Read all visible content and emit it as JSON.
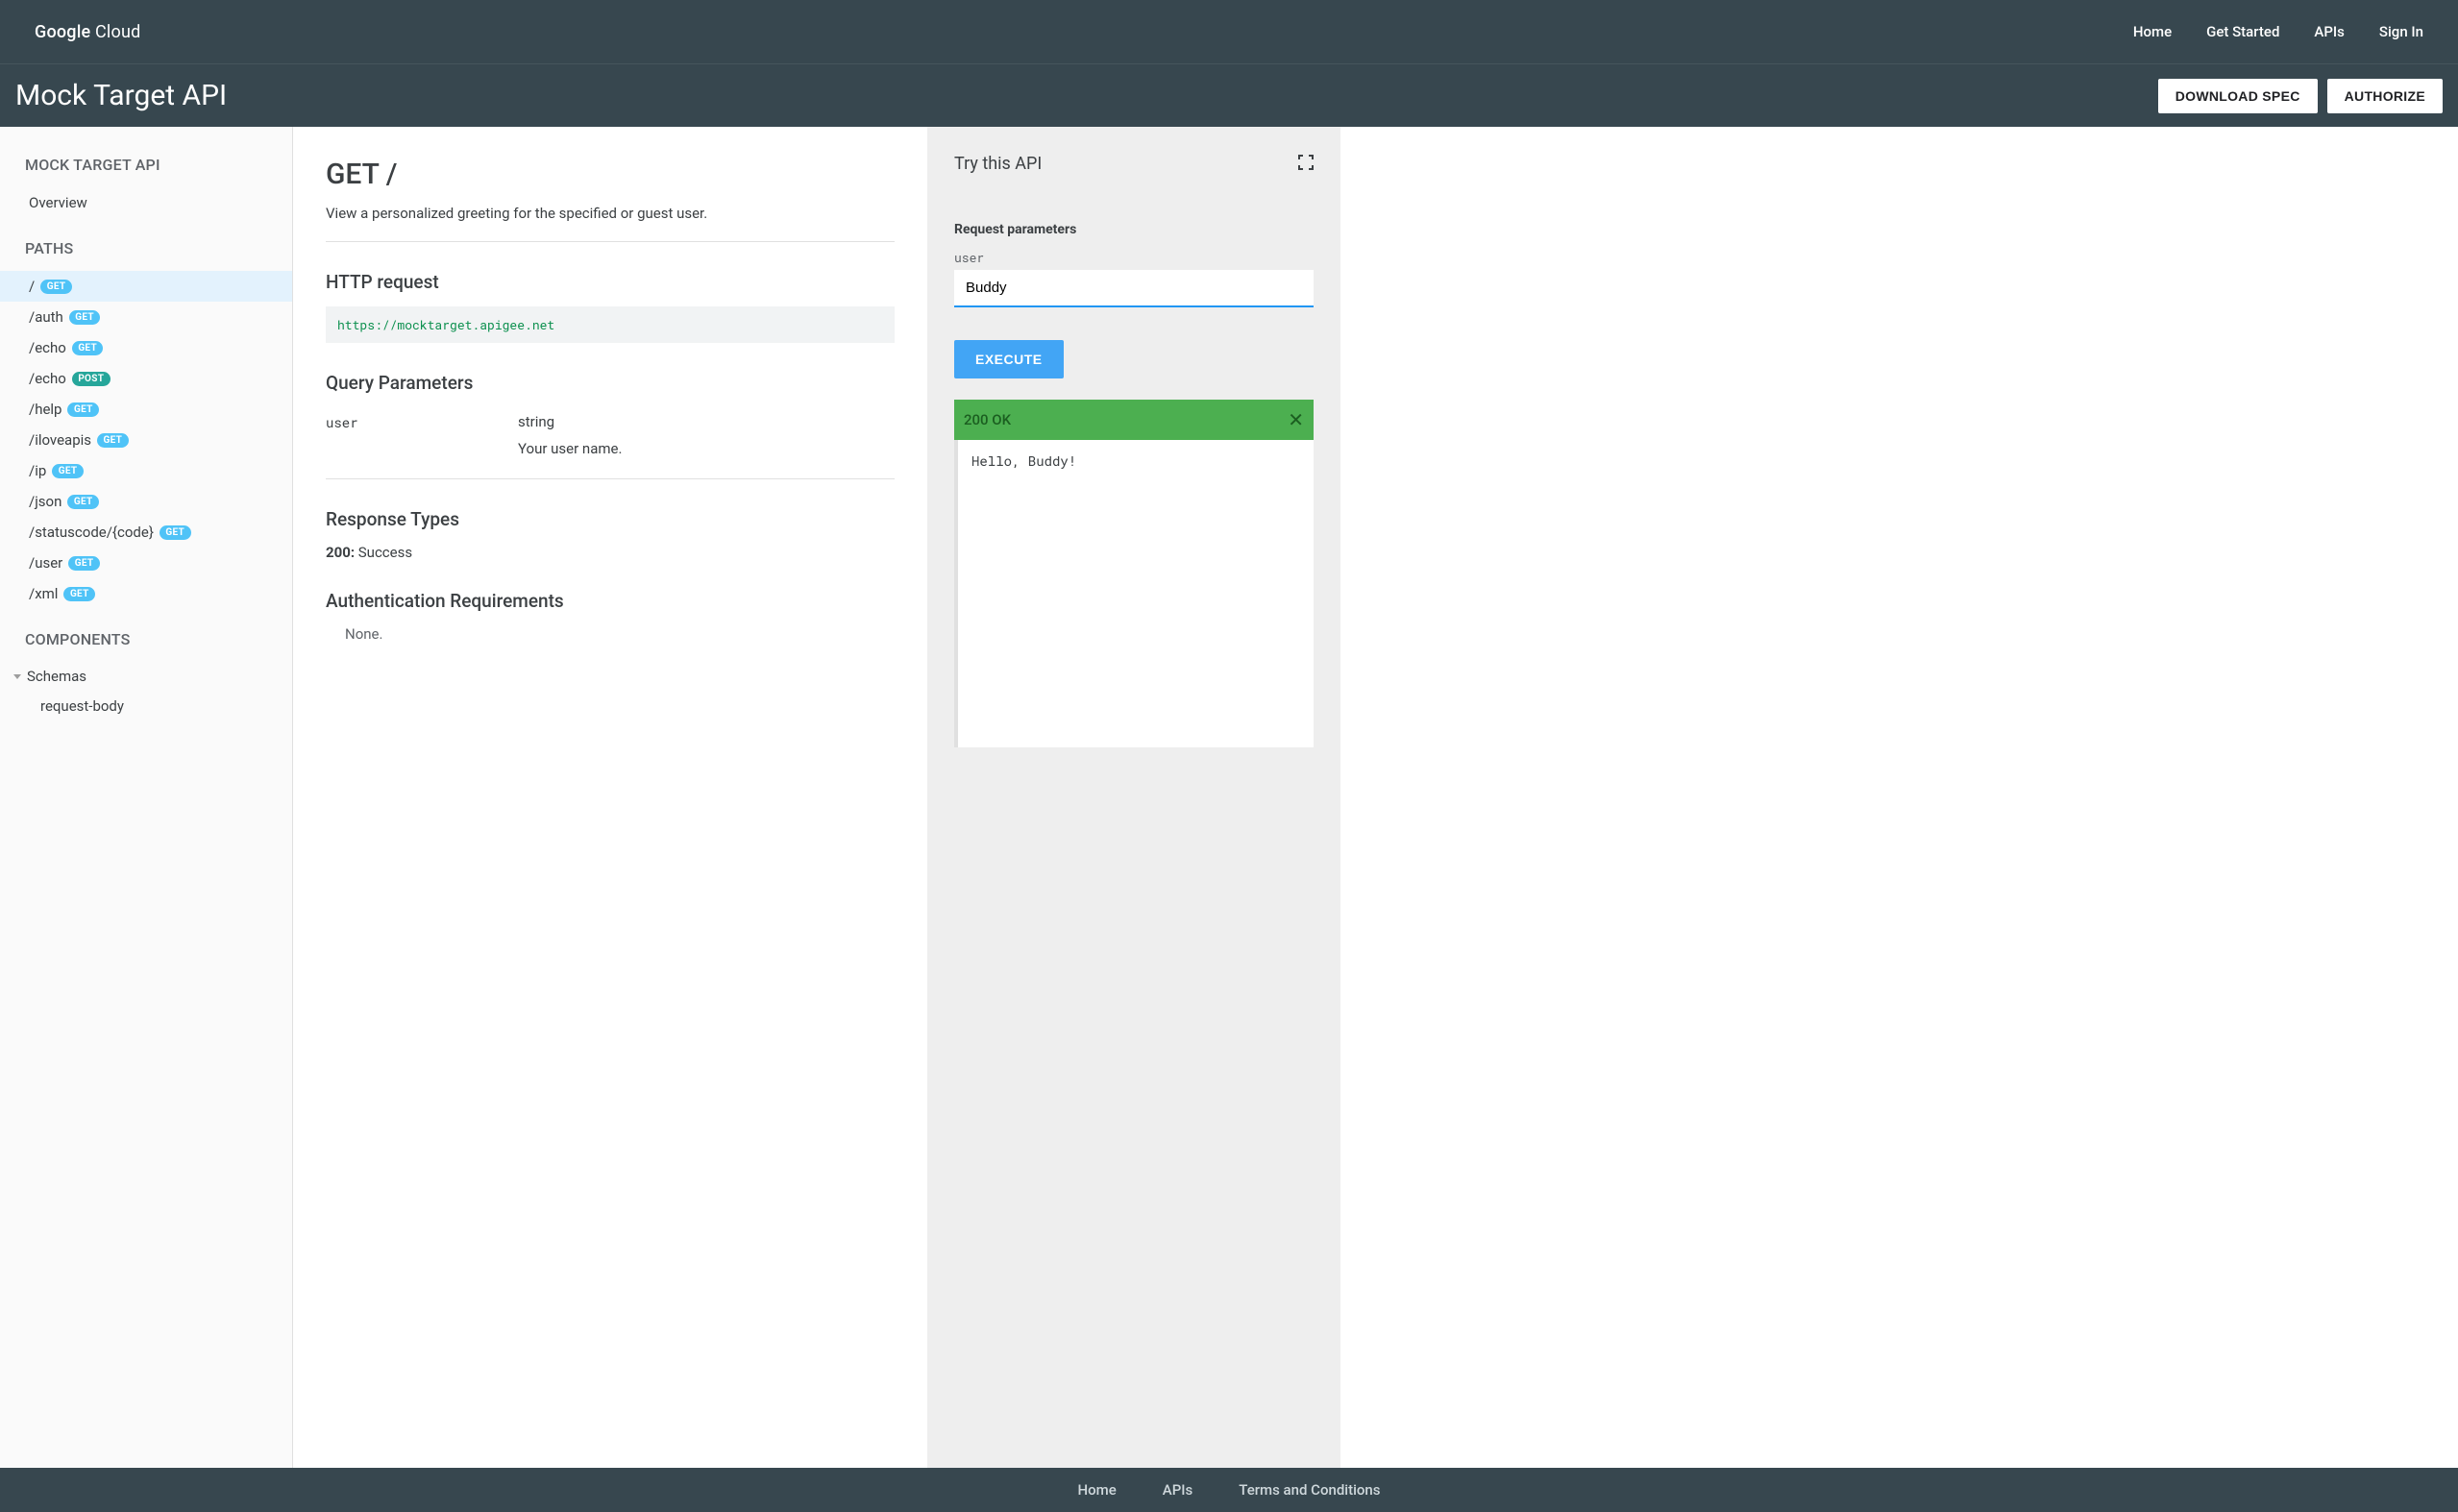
{
  "header": {
    "logo_prefix": "Google",
    "logo_suffix": " Cloud",
    "nav": [
      "Home",
      "Get Started",
      "APIs",
      "Sign In"
    ]
  },
  "subheader": {
    "title": "Mock Target API",
    "download_spec": "DOWNLOAD SPEC",
    "authorize": "AUTHORIZE"
  },
  "sidebar": {
    "api_title": "MOCK TARGET API",
    "overview": "Overview",
    "paths_label": "PATHS",
    "paths": [
      {
        "path": "/",
        "method": "GET",
        "method_class": "get",
        "active": true
      },
      {
        "path": "/auth",
        "method": "GET",
        "method_class": "get",
        "active": false
      },
      {
        "path": "/echo",
        "method": "GET",
        "method_class": "get",
        "active": false
      },
      {
        "path": "/echo",
        "method": "POST",
        "method_class": "post",
        "active": false
      },
      {
        "path": "/help",
        "method": "GET",
        "method_class": "get",
        "active": false
      },
      {
        "path": "/iloveapis",
        "method": "GET",
        "method_class": "get",
        "active": false
      },
      {
        "path": "/ip",
        "method": "GET",
        "method_class": "get",
        "active": false
      },
      {
        "path": "/json",
        "method": "GET",
        "method_class": "get",
        "active": false
      },
      {
        "path": "/statuscode/{code}",
        "method": "GET",
        "method_class": "get",
        "active": false
      },
      {
        "path": "/user",
        "method": "GET",
        "method_class": "get",
        "active": false
      },
      {
        "path": "/xml",
        "method": "GET",
        "method_class": "get",
        "active": false
      }
    ],
    "components_label": "COMPONENTS",
    "schemas_label": "Schemas",
    "schema_item": "request-body"
  },
  "main": {
    "title": "GET /",
    "description": "View a personalized greeting for the specified or guest user.",
    "http_request_label": "HTTP request",
    "http_url": "https://mocktarget.apigee.net",
    "query_params_label": "Query Parameters",
    "params": [
      {
        "name": "user",
        "type": "string",
        "desc": "Your user name."
      }
    ],
    "response_types_label": "Response Types",
    "response_code": "200:",
    "response_text": " Success",
    "auth_label": "Authentication Requirements",
    "auth_none": "None."
  },
  "try": {
    "title": "Try this API",
    "request_parameters": "Request parameters",
    "param_name": "user",
    "param_value": "Buddy",
    "execute": "EXECUTE",
    "status": "200 OK",
    "response_body": "Hello, Buddy!"
  },
  "footer": {
    "links": [
      "Home",
      "APIs",
      "Terms and Conditions"
    ]
  }
}
